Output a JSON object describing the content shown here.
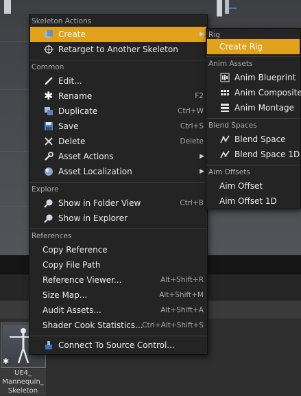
{
  "menu": {
    "sections": [
      {
        "header": "Skeleton Actions",
        "items": [
          {
            "label": "Create",
            "icon": "create-icon",
            "has_submenu": true,
            "highlighted": true
          },
          {
            "label": "Retarget to Another Skeleton",
            "icon": "crosshair-icon"
          }
        ]
      },
      {
        "header": "Common",
        "items": [
          {
            "label": "Edit...",
            "icon": "pencil-icon"
          },
          {
            "label": "Rename",
            "icon": "asterisk-icon",
            "shortcut": "F2"
          },
          {
            "label": "Duplicate",
            "icon": "duplicate-icon",
            "shortcut": "Ctrl+W"
          },
          {
            "label": "Save",
            "icon": "floppy-icon",
            "shortcut": "Ctrl+S"
          },
          {
            "label": "Delete",
            "icon": "x-icon",
            "shortcut": "Delete"
          },
          {
            "label": "Asset Actions",
            "icon": "wrench-icon",
            "has_submenu": true
          },
          {
            "label": "Asset Localization",
            "icon": "globe-icon",
            "has_submenu": true
          }
        ]
      },
      {
        "header": "Explore",
        "items": [
          {
            "label": "Show in Folder View",
            "icon": "magnifier-icon",
            "shortcut": "Ctrl+B"
          },
          {
            "label": "Show in Explorer",
            "icon": "magnifier-icon"
          }
        ]
      },
      {
        "header": "References",
        "items": [
          {
            "label": "Copy Reference"
          },
          {
            "label": "Copy File Path"
          },
          {
            "label": "Reference Viewer...",
            "shortcut": "Alt+Shift+R"
          },
          {
            "label": "Size Map...",
            "shortcut": "Alt+Shift+M"
          },
          {
            "label": "Audit Assets...",
            "shortcut": "Alt+Shift+A"
          },
          {
            "label": "Shader Cook Statistics...",
            "shortcut": "Ctrl+Alt+Shift+S"
          }
        ]
      },
      {
        "header": "",
        "items": [
          {
            "label": "Connect To Source Control...",
            "icon": "source-control-icon"
          }
        ]
      }
    ]
  },
  "submenu": {
    "sections": [
      {
        "header": "Rig",
        "items": [
          {
            "label": "Create Rig",
            "highlighted": true
          }
        ]
      },
      {
        "header": "Anim Assets",
        "items": [
          {
            "label": "Anim Blueprint",
            "icon": "anim-blueprint-icon"
          },
          {
            "label": "Anim Composite",
            "icon": "anim-composite-icon"
          },
          {
            "label": "Anim Montage",
            "icon": "anim-montage-icon"
          }
        ]
      },
      {
        "header": "Blend Spaces",
        "items": [
          {
            "label": "Blend Space",
            "icon": "blend-space-icon"
          },
          {
            "label": "Blend Space 1D",
            "icon": "blend-space-1d-icon"
          }
        ]
      },
      {
        "header": "Aim Offsets",
        "items": [
          {
            "label": "Aim Offset"
          },
          {
            "label": "Aim Offset 1D"
          }
        ]
      }
    ]
  },
  "asset": {
    "name_line1": "UE4_",
    "name_line2": "Mannequin_",
    "name_line3": "Skeleton"
  },
  "colors": {
    "highlight": "#e0a11c",
    "menu_bg": "#242424",
    "section_text": "#a9a9a9"
  }
}
